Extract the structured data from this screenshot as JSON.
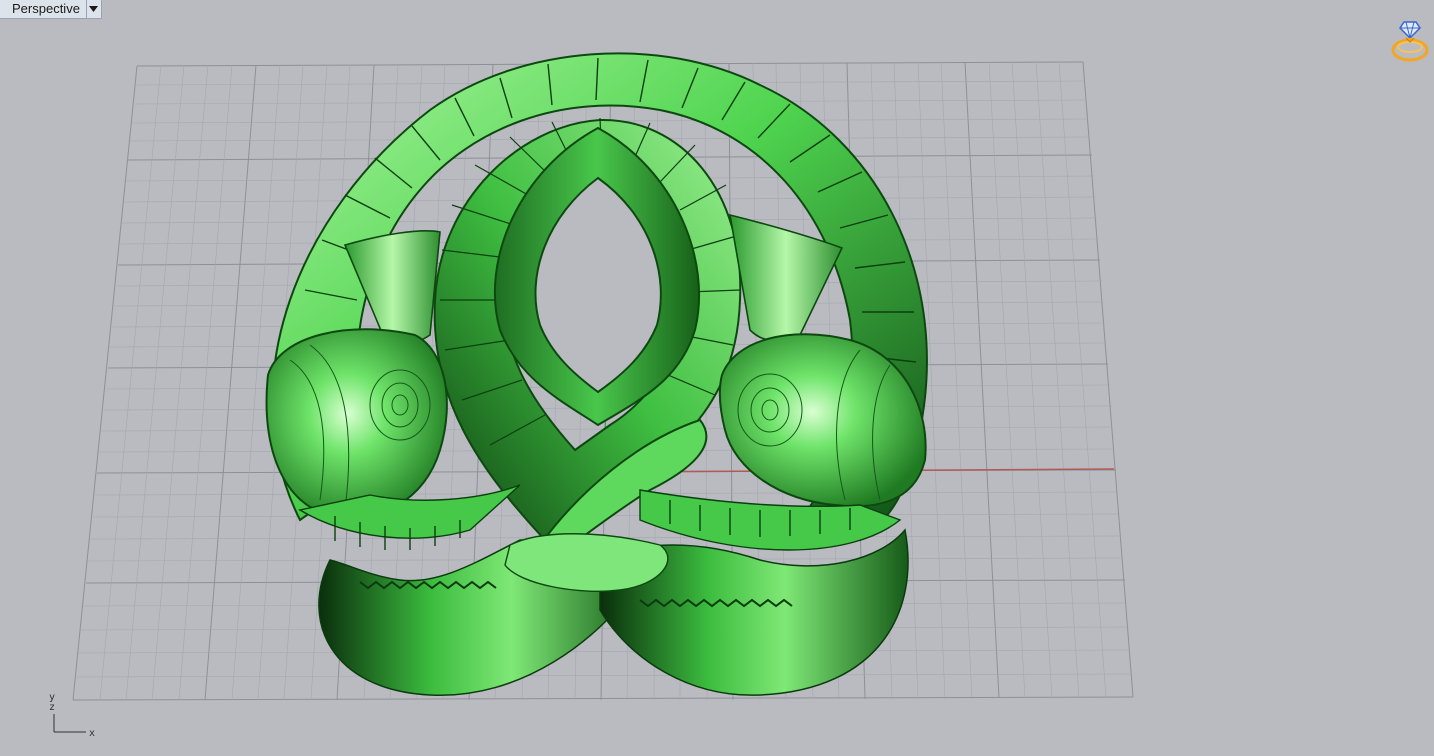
{
  "viewport": {
    "title": "Perspective",
    "menu_icon": "dropdown-arrow-icon"
  },
  "axes": {
    "x_label": "x",
    "z_label": "z",
    "y_label": "y"
  },
  "display_mode_icon": "ring-gem-icon",
  "colors": {
    "background": "#b9bbc1",
    "grid": "#8d9098",
    "x_axis": "#b25a55",
    "y_axis": "#4e9e58",
    "model_green": "#5cd85c",
    "icon_gold": "#f2a622"
  }
}
